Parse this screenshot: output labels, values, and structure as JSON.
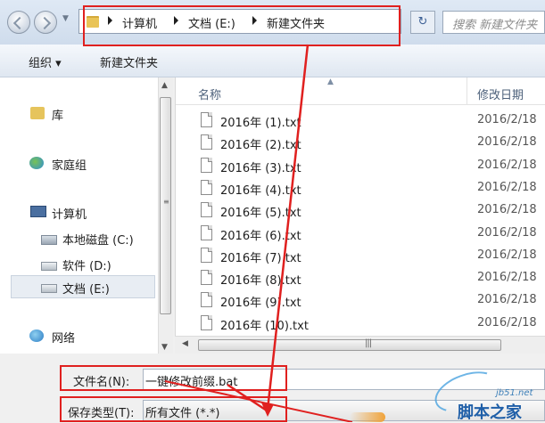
{
  "address_bar": {
    "crumbs": [
      "计算机",
      "文档 (E:)",
      "新建文件夹"
    ],
    "search_placeholder": "搜索 新建文件夹",
    "refresh_icon": "↻"
  },
  "toolbar": {
    "organize_label": "组织 ▾",
    "new_folder_label": "新建文件夹"
  },
  "nav_pane": {
    "library": "库",
    "homegroup": "家庭组",
    "computer": "计算机",
    "drive_c": "本地磁盘 (C:)",
    "drive_d": "软件 (D:)",
    "drive_e": "文档 (E:)",
    "network": "网络"
  },
  "file_list": {
    "col_name": "名称",
    "col_date": "修改日期",
    "files": [
      {
        "name": "2016年 (1).txt",
        "date": "2016/2/18"
      },
      {
        "name": "2016年 (2).txt",
        "date": "2016/2/18"
      },
      {
        "name": "2016年 (3).txt",
        "date": "2016/2/18"
      },
      {
        "name": "2016年 (4).txt",
        "date": "2016/2/18"
      },
      {
        "name": "2016年 (5).txt",
        "date": "2016/2/18"
      },
      {
        "name": "2016年 (6).txt",
        "date": "2016/2/18"
      },
      {
        "name": "2016年 (7).txt",
        "date": "2016/2/18"
      },
      {
        "name": "2016年 (8).txt",
        "date": "2016/2/18"
      },
      {
        "name": "2016年 (9).txt",
        "date": "2016/2/18"
      },
      {
        "name": "2016年 (10).txt",
        "date": "2016/2/18"
      }
    ]
  },
  "bottom_form": {
    "filename_label": "文件名(N):",
    "filename_value": "一键修改前缀.bat",
    "filetype_label": "保存类型(T):",
    "filetype_value": "所有文件 (*.*)"
  },
  "watermark": {
    "domain": "jb51.net",
    "name": "脚本之家"
  },
  "colors": {
    "annotation_red": "#e0201f",
    "selection_bg": "#e8edf3",
    "watermark_blue": "#1f5fa8"
  },
  "icons": {
    "back": "back-arrow-icon",
    "forward": "forward-arrow-icon",
    "folder": "folder-icon",
    "library": "library-icon",
    "homegroup": "homegroup-icon",
    "computer": "computer-icon",
    "drive": "drive-icon",
    "network": "network-icon",
    "file": "text-file-icon"
  }
}
